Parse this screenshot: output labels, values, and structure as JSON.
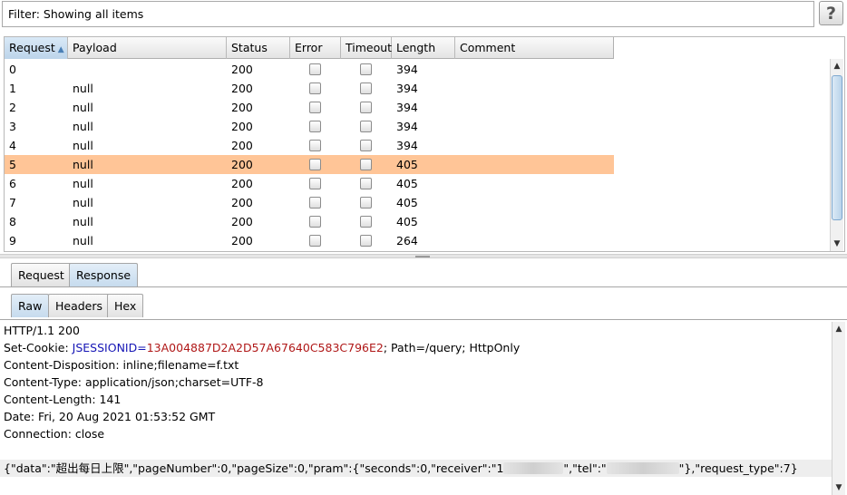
{
  "filter": {
    "text": "Filter: Showing all items"
  },
  "help": {
    "label": "?"
  },
  "table": {
    "columns": [
      "Request",
      "Payload",
      "Status",
      "Error",
      "Timeout",
      "Length",
      "Comment"
    ],
    "rows": [
      {
        "request": "0",
        "payload": "",
        "status": "200",
        "length": "394"
      },
      {
        "request": "1",
        "payload": "null",
        "status": "200",
        "length": "394"
      },
      {
        "request": "2",
        "payload": "null",
        "status": "200",
        "length": "394"
      },
      {
        "request": "3",
        "payload": "null",
        "status": "200",
        "length": "394"
      },
      {
        "request": "4",
        "payload": "null",
        "status": "200",
        "length": "394"
      },
      {
        "request": "5",
        "payload": "null",
        "status": "200",
        "length": "405"
      },
      {
        "request": "6",
        "payload": "null",
        "status": "200",
        "length": "405"
      },
      {
        "request": "7",
        "payload": "null",
        "status": "200",
        "length": "405"
      },
      {
        "request": "8",
        "payload": "null",
        "status": "200",
        "length": "405"
      },
      {
        "request": "9",
        "payload": "null",
        "status": "200",
        "length": "264"
      }
    ],
    "selected_row": "5",
    "selected_color": "#ffc597"
  },
  "tabs": {
    "top": [
      "Request",
      "Response"
    ],
    "top_active": "Response",
    "sub": [
      "Raw",
      "Headers",
      "Hex"
    ],
    "sub_active": "Raw"
  },
  "response": {
    "status_line": "HTTP/1.1 200",
    "set_cookie_prefix": "Set-Cookie: ",
    "cookie_name": "JSESSIONID",
    "cookie_eq": "=",
    "cookie_value": "13A004887D2A2D57A67640C583C796E2",
    "cookie_suffix": "; Path=/query; HttpOnly",
    "content_disposition": "Content-Disposition: inline;filename=f.txt",
    "content_type": "Content-Type: application/json;charset=UTF-8",
    "content_length": "Content-Length: 141",
    "date": "Date: Fri, 20 Aug 2021 01:53:52 GMT",
    "connection": "Connection: close",
    "body_part1": "{\"data\":\"超出每日上限\",\"pageNumber\":0,\"pageSize\":0,\"pram\":{\"seconds\":0,\"receiver\":\"1",
    "body_part2": "\",\"tel\":\"",
    "body_part3": "\"},\"request_type\":7}"
  },
  "colors": {
    "accent_blue": "#1515b5",
    "cookie_red": "#b01818"
  }
}
